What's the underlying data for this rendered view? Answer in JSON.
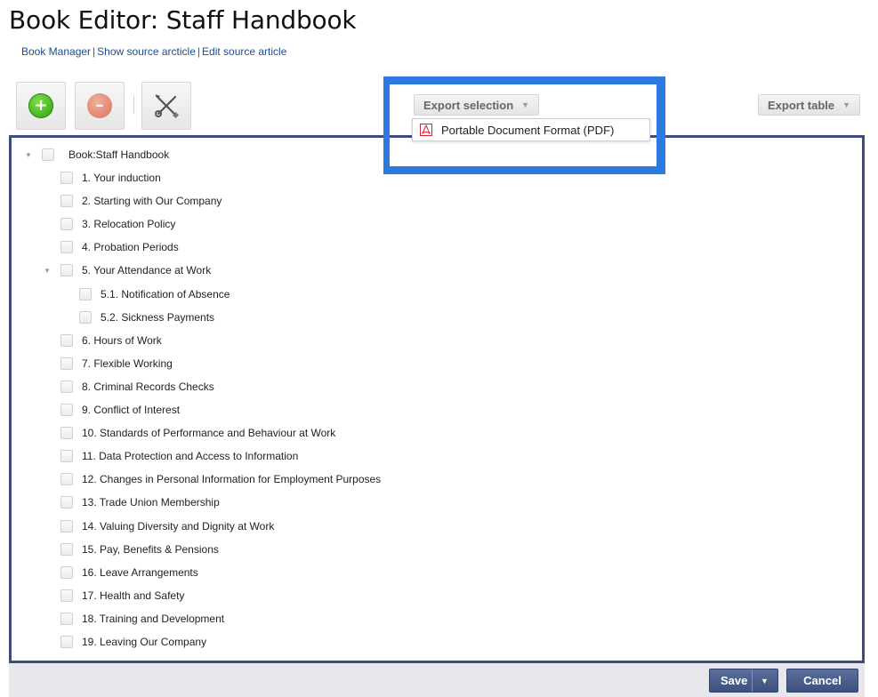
{
  "header": {
    "title": "Book Editor: Staff Handbook",
    "links": [
      "Book Manager",
      "Show source arcticle",
      "Edit source article"
    ],
    "link_separator": "|"
  },
  "toolbar": {
    "add_icon_glyph": "+",
    "remove_icon_glyph": "–",
    "export_selection_label": "Export selection",
    "export_table_label": "Export table",
    "caret": "▼"
  },
  "export_dropdown": {
    "options": [
      "Portable Document Format (PDF)"
    ]
  },
  "tree": {
    "toggle_glyph": "▼",
    "root": {
      "label": "Book:Staff Handbook",
      "expanded": true
    },
    "items": [
      {
        "label": "1. Your induction",
        "level": 1
      },
      {
        "label": "2. Starting with Our Company",
        "level": 1
      },
      {
        "label": "3. Relocation Policy",
        "level": 1
      },
      {
        "label": "4. Probation Periods",
        "level": 1
      },
      {
        "label": "5. Your Attendance at Work",
        "level": 1,
        "expanded": true
      },
      {
        "label": "5.1. Notification of Absence",
        "level": 2
      },
      {
        "label": "5.2. Sickness Payments",
        "level": 2
      },
      {
        "label": "6. Hours of Work",
        "level": 1
      },
      {
        "label": "7. Flexible Working",
        "level": 1
      },
      {
        "label": "8. Criminal Records Checks",
        "level": 1
      },
      {
        "label": "9. Conflict of Interest",
        "level": 1
      },
      {
        "label": "10. Standards of Performance and Behaviour at Work",
        "level": 1
      },
      {
        "label": "11. Data Protection and Access to Information",
        "level": 1
      },
      {
        "label": "12. Changes in Personal Information for Employment Purposes",
        "level": 1
      },
      {
        "label": "13. Trade Union Membership",
        "level": 1
      },
      {
        "label": "14. Valuing Diversity and Dignity at Work",
        "level": 1
      },
      {
        "label": "15. Pay, Benefits & Pensions",
        "level": 1
      },
      {
        "label": "16. Leave Arrangements",
        "level": 1
      },
      {
        "label": "17. Health and Safety",
        "level": 1
      },
      {
        "label": "18. Training and Development",
        "level": 1
      },
      {
        "label": "19. Leaving Our Company",
        "level": 1
      }
    ]
  },
  "footer": {
    "save_label": "Save",
    "cancel_label": "Cancel",
    "caret": "▼"
  },
  "colors": {
    "panel_border": "#3e4d7e",
    "highlight": "#2d7be0",
    "link": "#1d4c8c",
    "button_primary": "#4a5b8a"
  }
}
